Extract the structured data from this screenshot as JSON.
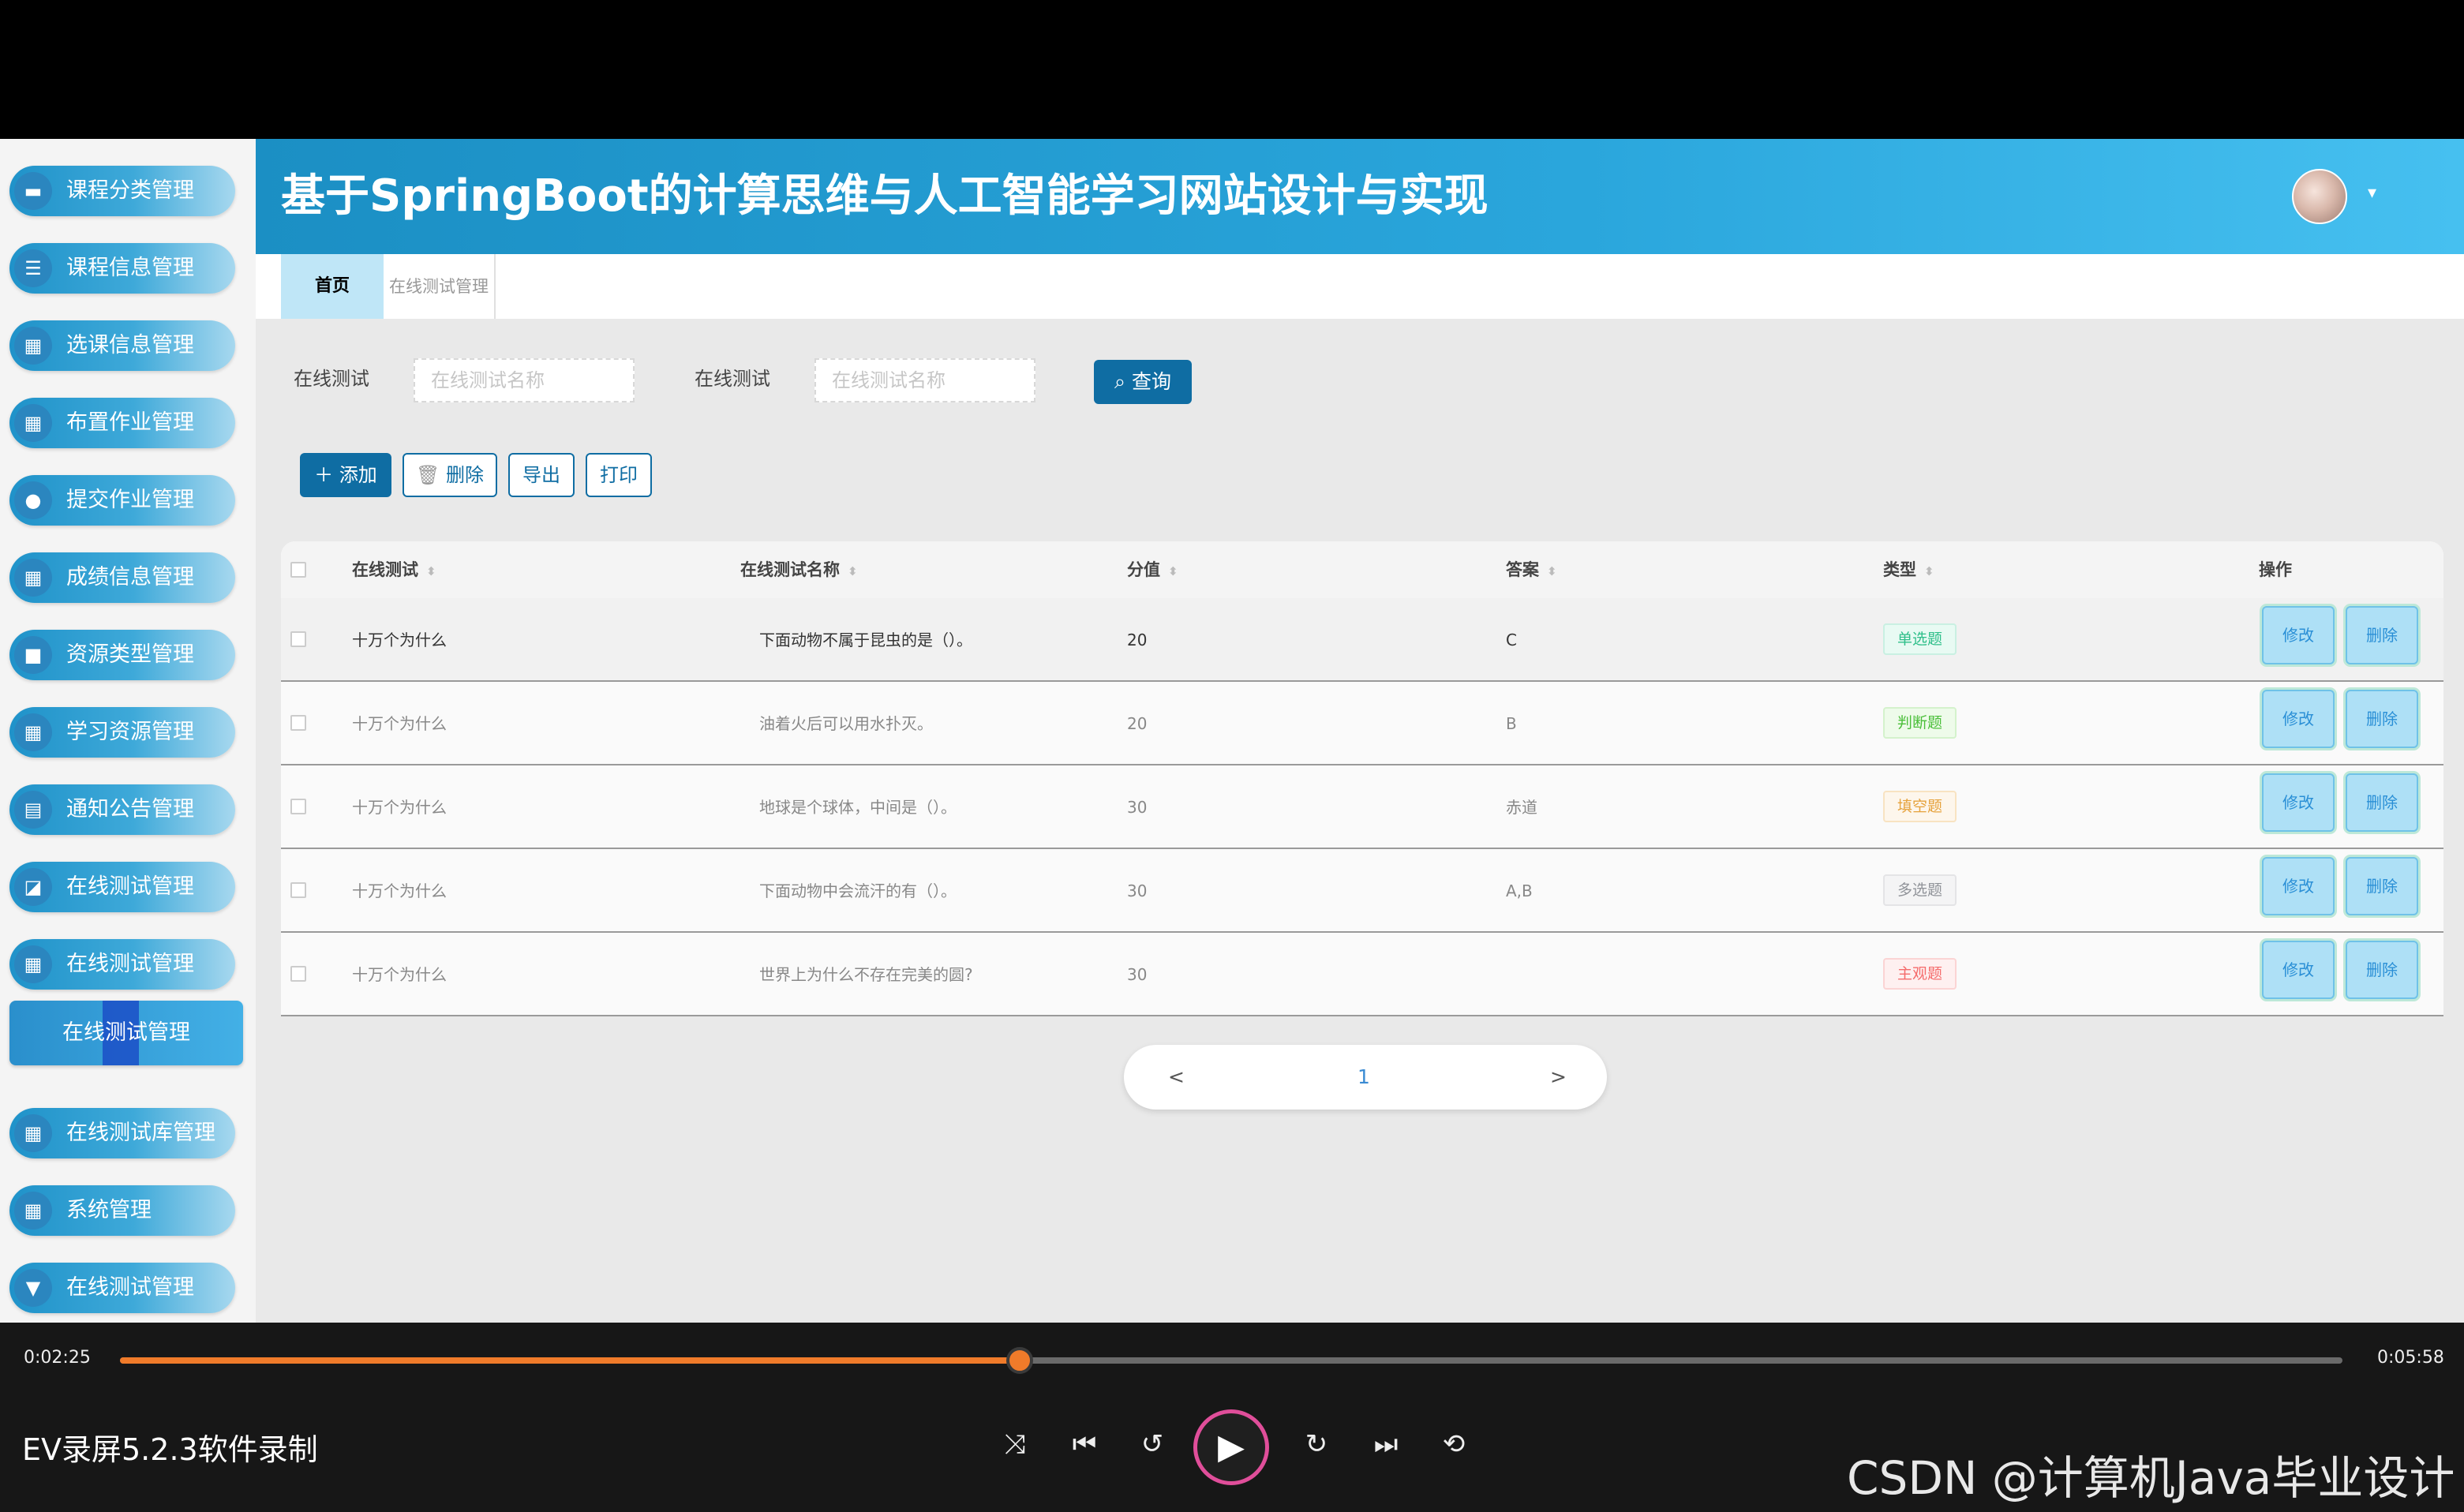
{
  "app": {
    "title": "基于SpringBoot的计算思维与人工智能学习网站设计与实现"
  },
  "sidebar": {
    "items": [
      {
        "label": "课程分类管理",
        "icon": "book-icon"
      },
      {
        "label": "课程信息管理",
        "icon": "list-icon"
      },
      {
        "label": "选课信息管理",
        "icon": "grid-icon"
      },
      {
        "label": "布置作业管理",
        "icon": "grid-icon"
      },
      {
        "label": "提交作业管理",
        "icon": "user-icon"
      },
      {
        "label": "成绩信息管理",
        "icon": "grid-icon"
      },
      {
        "label": "资源类型管理",
        "icon": "briefcase-icon"
      },
      {
        "label": "学习资源管理",
        "icon": "grid-icon"
      },
      {
        "label": "通知公告管理",
        "icon": "table-icon"
      },
      {
        "label": "在线测试管理",
        "icon": "chart-icon"
      },
      {
        "label": "在线测试管理",
        "icon": "grid-icon"
      },
      {
        "label": "在线测试库管理",
        "icon": "grid-icon"
      },
      {
        "label": "系统管理",
        "icon": "grid-icon"
      },
      {
        "label": "在线测试管理",
        "icon": "pin-icon"
      }
    ],
    "submenu_label": "在线测试管理"
  },
  "tabs": {
    "home": "首页",
    "current": "在线测试管理"
  },
  "search": {
    "label1": "在线测试",
    "placeholder1": "在线测试名称",
    "label2": "在线测试",
    "placeholder2": "在线测试名称",
    "query": "查询"
  },
  "actions": {
    "add": "添加",
    "delete": "删除",
    "export": "导出",
    "print": "打印"
  },
  "table": {
    "columns": [
      "在线测试",
      "在线测试名称",
      "分值",
      "答案",
      "类型",
      "操作"
    ],
    "rows": [
      {
        "test": "十万个为什么",
        "name": "下面动物不属于昆虫的是（）。",
        "score": "20",
        "answer": "C",
        "type": "单选题",
        "type_color": "#2fbf8a"
      },
      {
        "test": "十万个为什么",
        "name": "油着火后可以用水扑灭。",
        "score": "20",
        "answer": "B",
        "type": "判断题",
        "type_color": "#4bbf3a"
      },
      {
        "test": "十万个为什么",
        "name": "地球是个球体，中间是（）。",
        "score": "30",
        "answer": "赤道",
        "type": "填空题",
        "type_color": "#e6a23c"
      },
      {
        "test": "十万个为什么",
        "name": "下面动物中会流汗的有（）。",
        "score": "30",
        "answer": "A,B",
        "type": "多选题",
        "type_color": "#909399"
      },
      {
        "test": "十万个为什么",
        "name": "世界上为什么不存在完美的圆?",
        "score": "30",
        "answer": "",
        "type": "主观题",
        "type_color": "#f56c6c"
      }
    ],
    "edit": "修改",
    "delete": "删除"
  },
  "pager": {
    "prev": "<",
    "page": "1",
    "next": ">"
  },
  "player": {
    "current_time": "0:02:25",
    "total_time": "0:05:58",
    "progress": 0.405,
    "recorder": "EV录屏5.2.3软件录制",
    "watermark": "CSDN @计算机Java毕业设计"
  }
}
